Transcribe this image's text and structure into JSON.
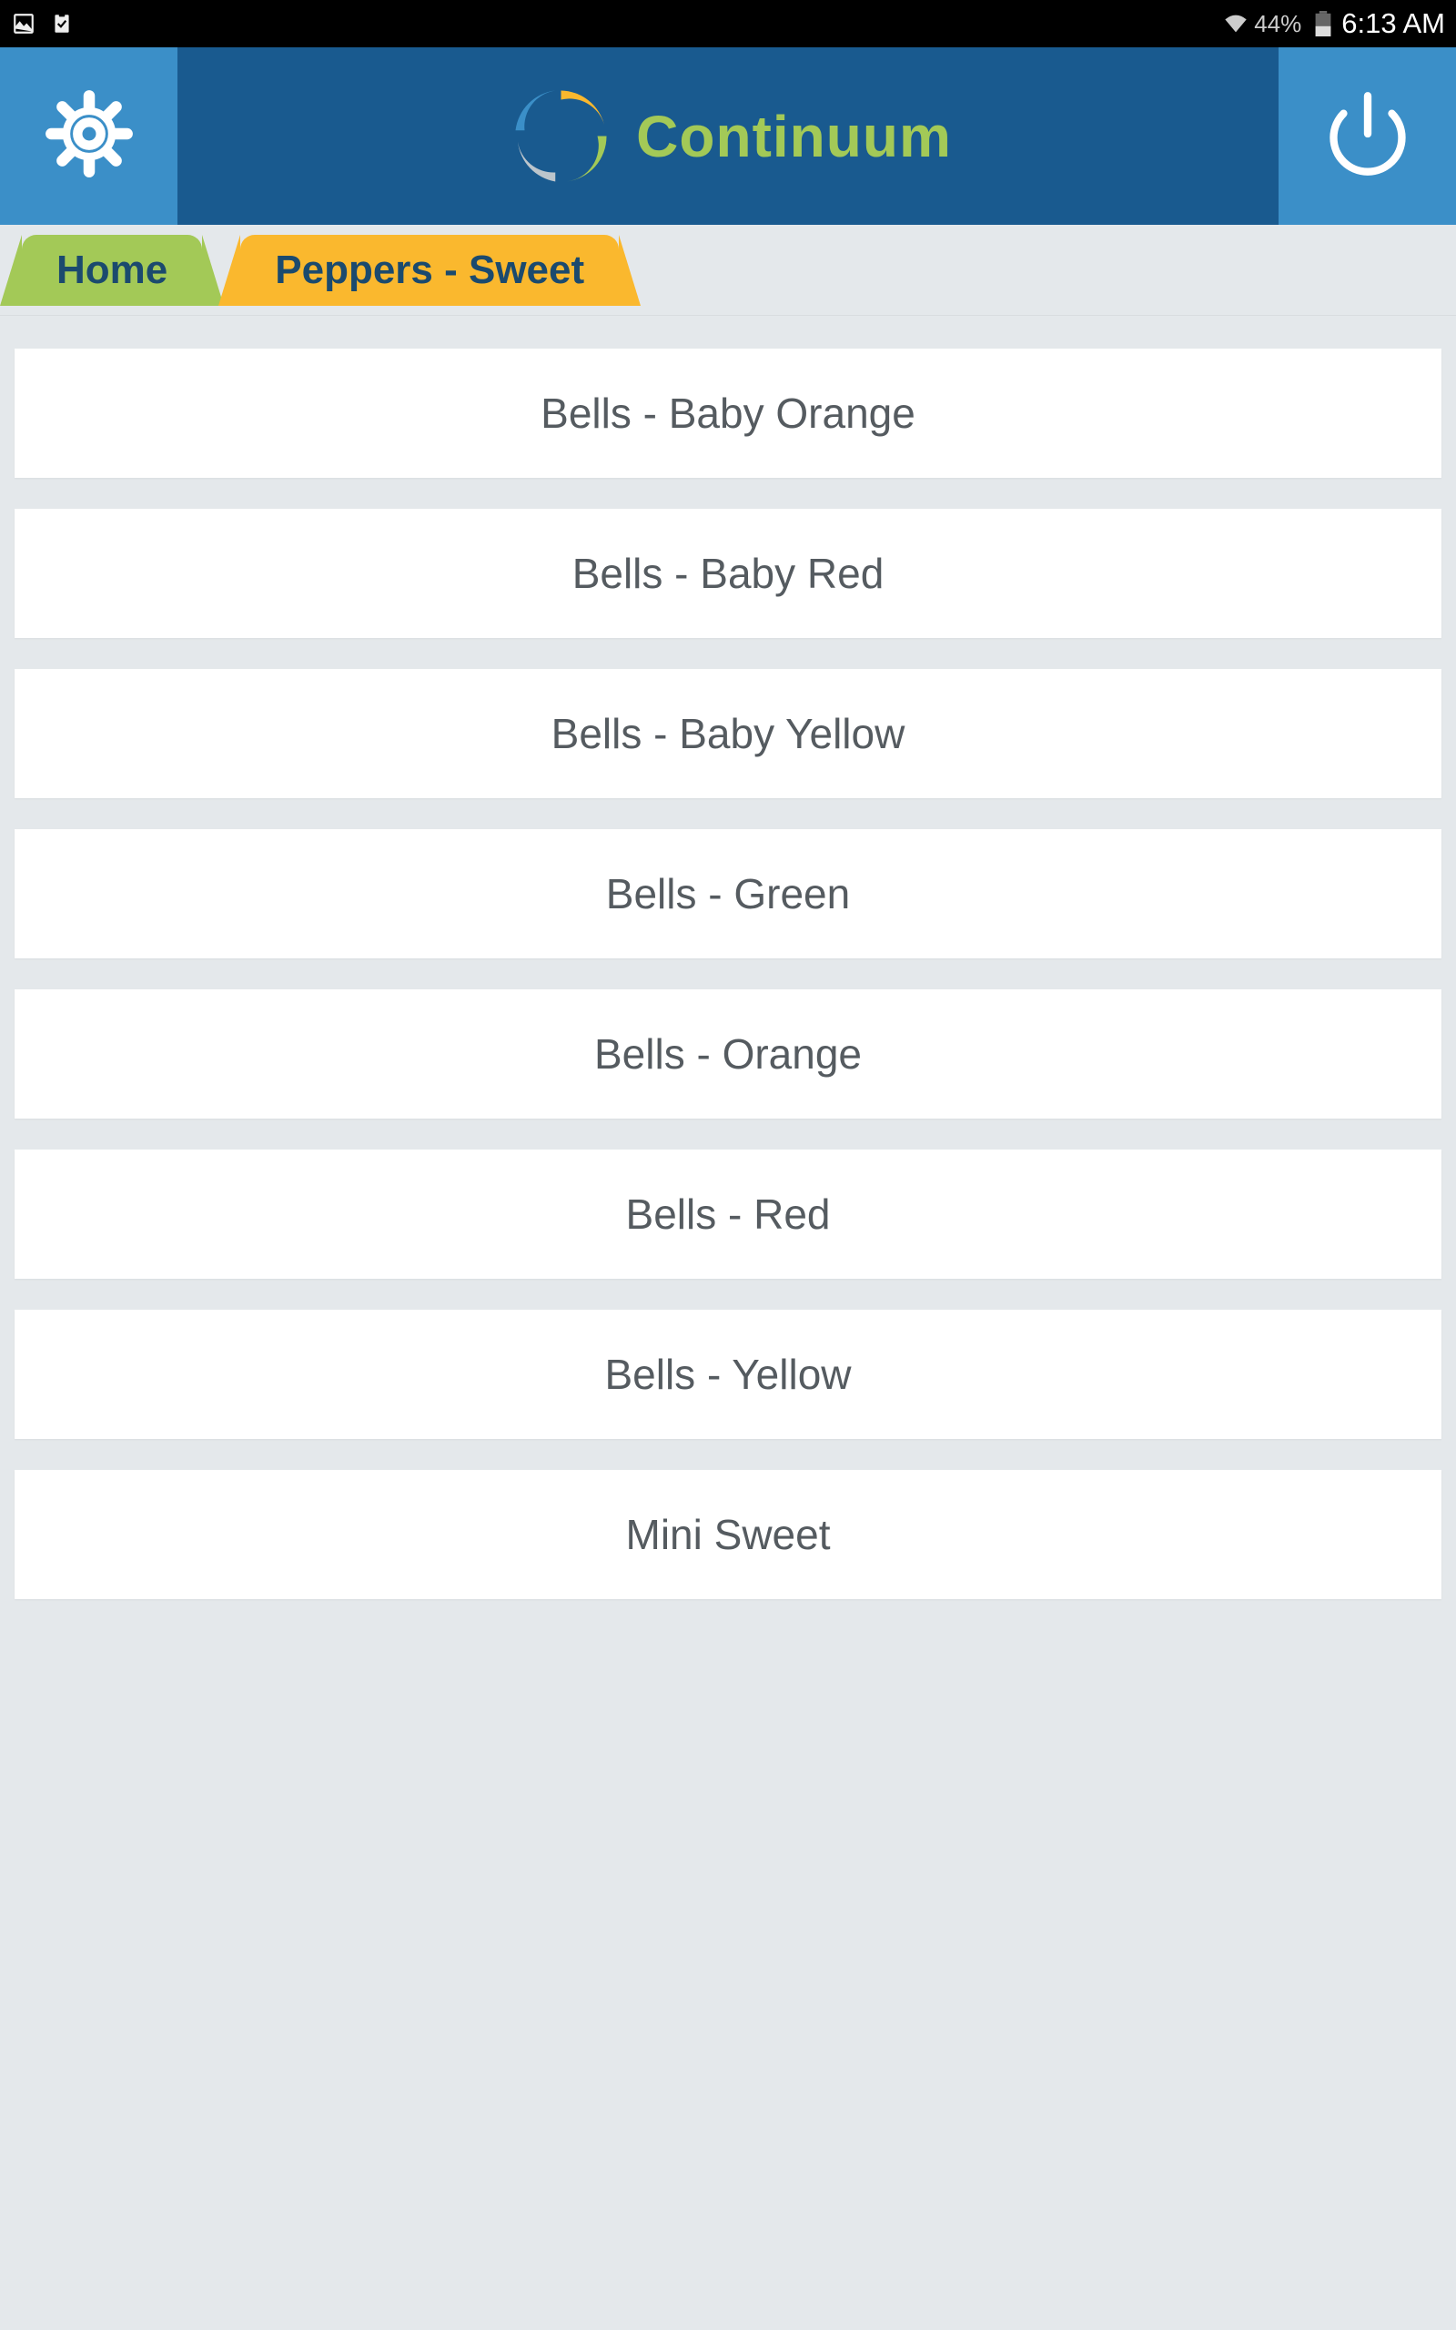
{
  "status_bar": {
    "battery_pct": "44%",
    "time": "6:13 AM"
  },
  "header": {
    "app_title": "Continuum"
  },
  "breadcrumb": {
    "home_label": "Home",
    "category_label": "Peppers - Sweet"
  },
  "items": [
    "Bells - Baby Orange",
    "Bells - Baby Red",
    "Bells - Baby Yellow",
    "Bells - Green",
    "Bells - Orange",
    "Bells - Red",
    "Bells - Yellow",
    "Mini Sweet"
  ]
}
